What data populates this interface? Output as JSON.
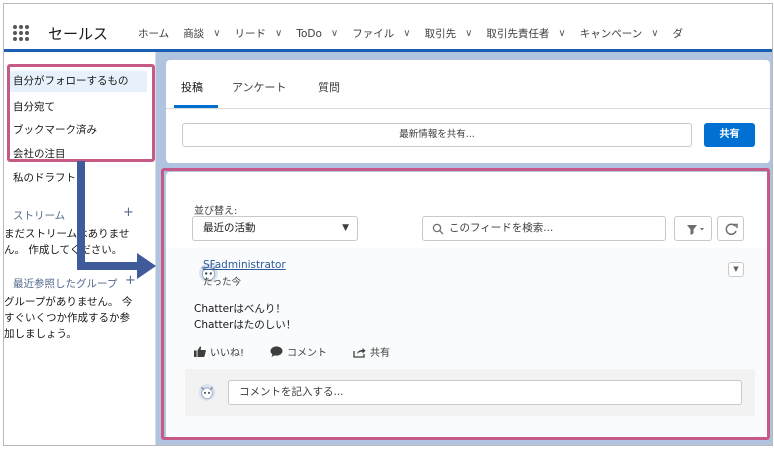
{
  "app": {
    "name": "セールス"
  },
  "nav": {
    "items": [
      {
        "label": "ホーム",
        "has_menu": false
      },
      {
        "label": "商談",
        "has_menu": true
      },
      {
        "label": "リード",
        "has_menu": true
      },
      {
        "label": "ToDo",
        "has_menu": true
      },
      {
        "label": "ファイル",
        "has_menu": true
      },
      {
        "label": "取引先",
        "has_menu": true
      },
      {
        "label": "取引先責任者",
        "has_menu": true
      },
      {
        "label": "キャンペーン",
        "has_menu": true
      },
      {
        "label": "ダ",
        "has_menu": false
      }
    ]
  },
  "sidebar": {
    "items": [
      {
        "label": "自分がフォローするもの",
        "selected": true
      },
      {
        "label": "自分宛て",
        "selected": false
      },
      {
        "label": "ブックマーク済み",
        "selected": false
      },
      {
        "label": "会社の注目",
        "selected": false
      },
      {
        "label": "私のドラフト",
        "selected": false
      }
    ],
    "streams": {
      "title": "ストリーム",
      "plus": "+",
      "empty_line1": "まだストリームはありませ",
      "empty_line2": "ん。 作成してください。"
    },
    "recent_groups": {
      "title": "最近参照したグループ",
      "plus": "+",
      "empty_line1": "グループがありません。 今",
      "empty_line2": "すぐいくつか作成するか参",
      "empty_line3": "加しましょう。"
    }
  },
  "publisher": {
    "tabs": [
      "投稿",
      "アンケート",
      "質問"
    ],
    "active_tab": "投稿",
    "share_placeholder": "最新情報を共有...",
    "share_button": "共有"
  },
  "feed": {
    "sort_label": "並び替え:",
    "sort_value": "最近の活動",
    "search_placeholder": "このフィードを検索...",
    "post": {
      "author": "SFadministrator",
      "time": "たった今",
      "body_line1": "Chatterはべんり！",
      "body_line2": "Chatterはたのしい！",
      "like_label": "いいね!",
      "comment_label": "コメント",
      "share_label": "共有"
    },
    "comment_placeholder": "コメントを記入する..."
  },
  "colors": {
    "accent": "#0070d2",
    "nav_underline": "#1b5fb4",
    "main_background": "#b0c4df",
    "callout_border": "#c55a86",
    "callout_arrow": "#3f5b9a"
  },
  "icons": {
    "app_launcher": "grid-icon",
    "search": "search-icon",
    "filter": "filter-icon",
    "refresh": "refresh-icon",
    "like": "thumbs-up-icon",
    "comment": "comment-bubble-icon",
    "share": "share-icon",
    "avatar": "astro-avatar-icon"
  }
}
